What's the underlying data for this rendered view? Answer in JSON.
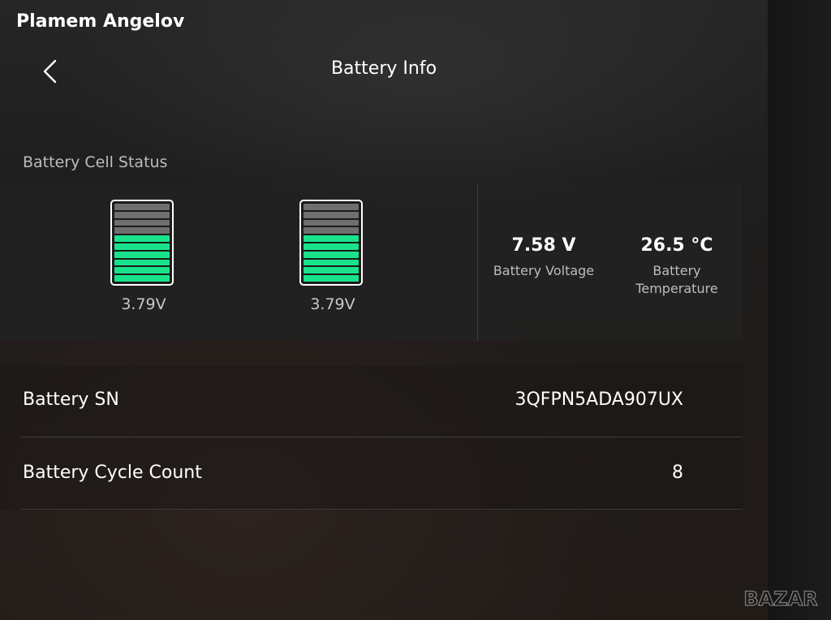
{
  "user": {
    "name": "Plamem Angelov"
  },
  "header": {
    "title": "Battery Info",
    "back_icon": "chevron-left-icon"
  },
  "cell_status": {
    "label": "Battery Cell Status",
    "cells": [
      {
        "voltage": "3.79V",
        "bars_total": 10,
        "bars_filled": 6
      },
      {
        "voltage": "3.79V",
        "bars_total": 10,
        "bars_filled": 6
      }
    ],
    "fill_color": "#19e38a",
    "empty_color": "#6f6f6f"
  },
  "stats": {
    "voltage": {
      "value": "7.58 V",
      "label": "Battery Voltage"
    },
    "temperature": {
      "value": "26.5 °C",
      "label_line1": "Battery",
      "label_line2": "Temperature"
    }
  },
  "info_rows": [
    {
      "label": "Battery SN",
      "value": "3QFPN5ADA907UX"
    },
    {
      "label": "Battery Cycle Count",
      "value": "8"
    }
  ],
  "watermark": {
    "text": "BAZAR"
  }
}
